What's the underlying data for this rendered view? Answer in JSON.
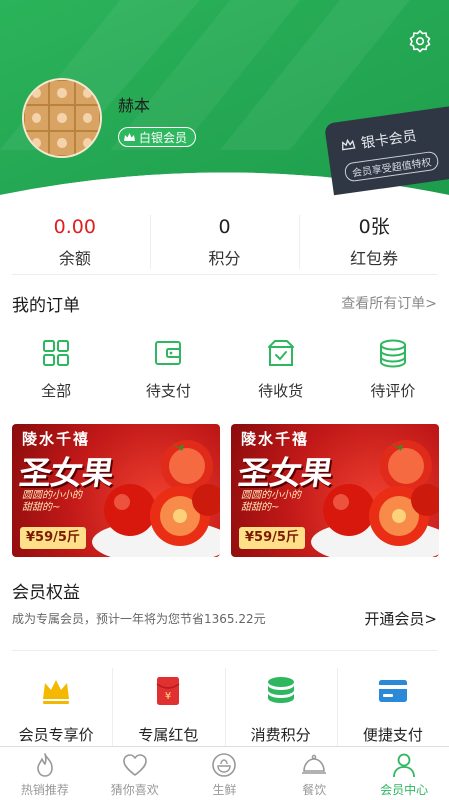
{
  "profile": {
    "username": "赫本",
    "member_level": "白银会员"
  },
  "silver_card": {
    "title": "银卡会员",
    "subtitle": "会员享受超值特权"
  },
  "stats": [
    {
      "value": "0.00",
      "label": "余额"
    },
    {
      "value": "0",
      "label": "积分"
    },
    {
      "value": "0张",
      "label": "红包券"
    }
  ],
  "orders": {
    "title": "我的订单",
    "view_all": "查看所有订单>",
    "items": [
      {
        "label": "全部",
        "icon": "grid-icon"
      },
      {
        "label": "待支付",
        "icon": "wallet-icon"
      },
      {
        "label": "待收货",
        "icon": "box-check-icon"
      },
      {
        "label": "待评价",
        "icon": "coins-stack-icon"
      }
    ]
  },
  "banners": [
    {
      "tag": "陵水千禧",
      "headline": "圣女果",
      "slogan": "圆圆的小小的\n甜甜的~",
      "price": "¥59/5斤"
    },
    {
      "tag": "陵水千禧",
      "headline": "圣女果",
      "slogan": "圆圆的小小的\n甜甜的~",
      "price": "¥59/5斤"
    }
  ],
  "benefits": {
    "title": "会员权益",
    "subtitle": "成为专属会员，预计一年将为您节省1365.22元",
    "open_link": "开通会员>",
    "items": [
      {
        "label": "会员专享价",
        "icon": "crown-icon"
      },
      {
        "label": "专属红包",
        "icon": "red-envelope-icon"
      },
      {
        "label": "消费积分",
        "icon": "coins-stack-icon"
      },
      {
        "label": "便捷支付",
        "icon": "card-icon"
      }
    ]
  },
  "tabbar": {
    "items": [
      {
        "label": "热销推荐",
        "icon": "flame-icon"
      },
      {
        "label": "猜你喜欢",
        "icon": "heart-icon"
      },
      {
        "label": "生鲜",
        "icon": "fresh-bowl-icon"
      },
      {
        "label": "餐饮",
        "icon": "dish-cover-icon"
      },
      {
        "label": "会员中心",
        "icon": "user-icon",
        "active": true
      }
    ]
  },
  "colors": {
    "brand_green": "#2fb760",
    "balance_red": "#e02020",
    "crown_gold": "#f5b800",
    "envelope_red": "#e03030",
    "card_blue": "#2a8ad8",
    "silver_card_bg": "#2f3744"
  }
}
